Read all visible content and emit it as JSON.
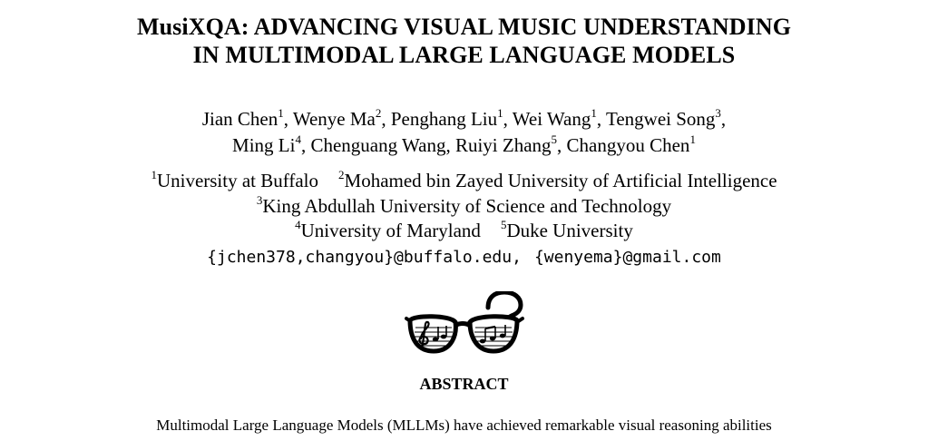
{
  "paper": {
    "title_line1": "MusiXQA: ADVANCING VISUAL MUSIC UNDERSTANDING",
    "title_line2": "IN MULTIMODAL LARGE LANGUAGE MODELS",
    "authors": [
      {
        "name": "Jian Chen",
        "aff": "1",
        "sep": ", "
      },
      {
        "name": "Wenye Ma",
        "aff": "2",
        "sep": ", "
      },
      {
        "name": "Penghang Liu",
        "aff": "1",
        "sep": ", "
      },
      {
        "name": "Wei Wang",
        "aff": "1",
        "sep": ", "
      },
      {
        "name": "Tengwei Song",
        "aff": "3",
        "sep": ","
      },
      {
        "name": "Ming Li",
        "aff": "4",
        "sep": ", "
      },
      {
        "name": "Chenguang Wang",
        "aff": "",
        "sep": ", "
      },
      {
        "name": "Ruiyi Zhang",
        "aff": "5",
        "sep": ", "
      },
      {
        "name": "Changyou Chen",
        "aff": "1",
        "sep": ""
      }
    ],
    "affiliations": [
      {
        "num": "1",
        "name": "University at Buffalo"
      },
      {
        "num": "2",
        "name": "Mohamed bin Zayed University of Artificial Intelligence"
      },
      {
        "num": "3",
        "name": "King Abdullah University of Science and Technology"
      },
      {
        "num": "4",
        "name": "University of Maryland"
      },
      {
        "num": "5",
        "name": "Duke University"
      }
    ],
    "emails": {
      "part1": "{jchen378,changyou}@buffalo.edu,",
      "part2": "{wenyema}@gmail.com"
    },
    "logo_icon": "glasses-music-question-icon",
    "abstract_heading": "ABSTRACT",
    "abstract_first_line": "Multimodal Large Language Models (MLLMs) have achieved remarkable visual reasoning abilities"
  }
}
